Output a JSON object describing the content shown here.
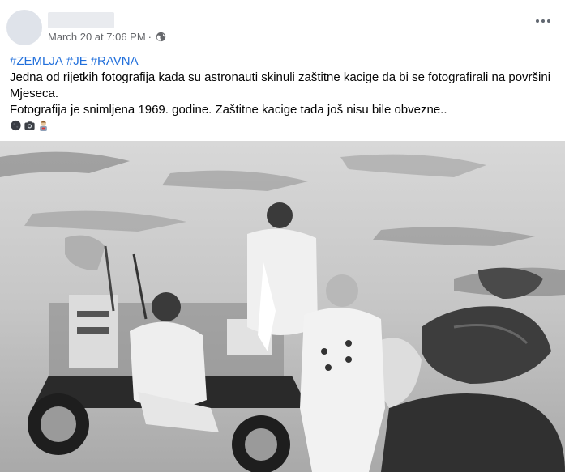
{
  "post": {
    "timestamp": "March 20 at 7:06 PM",
    "separator": "·",
    "privacy_icon": "globe-icon",
    "menu_icon": "more-options-icon",
    "hashtags": [
      "#ZEMLJA",
      "#JE",
      "#RAVNA"
    ],
    "line1": "Jedna od rijetkih fotografija kada su astronauti skinuli zaštitne kacige da bi se fotografirali na površini",
    "line2": "Mjeseca.",
    "line3": "Fotografija je snimljena 1969. godine. Zaštitne kacige tada još nisu bile obvezne..",
    "emojis": [
      "moon-icon",
      "camera-icon",
      "astronaut-icon"
    ]
  },
  "colors": {
    "link": "#216fdb",
    "meta": "#65676b",
    "text": "#050505"
  }
}
